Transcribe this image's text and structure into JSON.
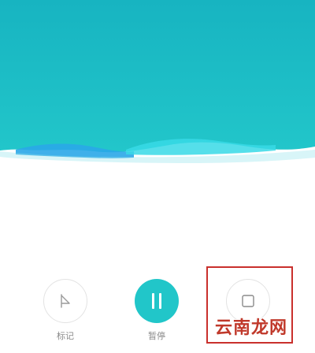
{
  "colors": {
    "accent": "#21c6c9",
    "wave_top": "#18b8c4",
    "wave_bottom": "#24c9ca",
    "wave_highlight": "#37d9e6",
    "wave_blue": "#2aa7e8",
    "highlight_box": "#c9302c"
  },
  "controls": {
    "mark": {
      "label": "标记",
      "icon": "flag-icon"
    },
    "pause": {
      "label": "暂停",
      "icon": "pause-icon"
    },
    "stop": {
      "icon": "stop-icon"
    }
  },
  "watermark": {
    "text": "云南龙网"
  }
}
